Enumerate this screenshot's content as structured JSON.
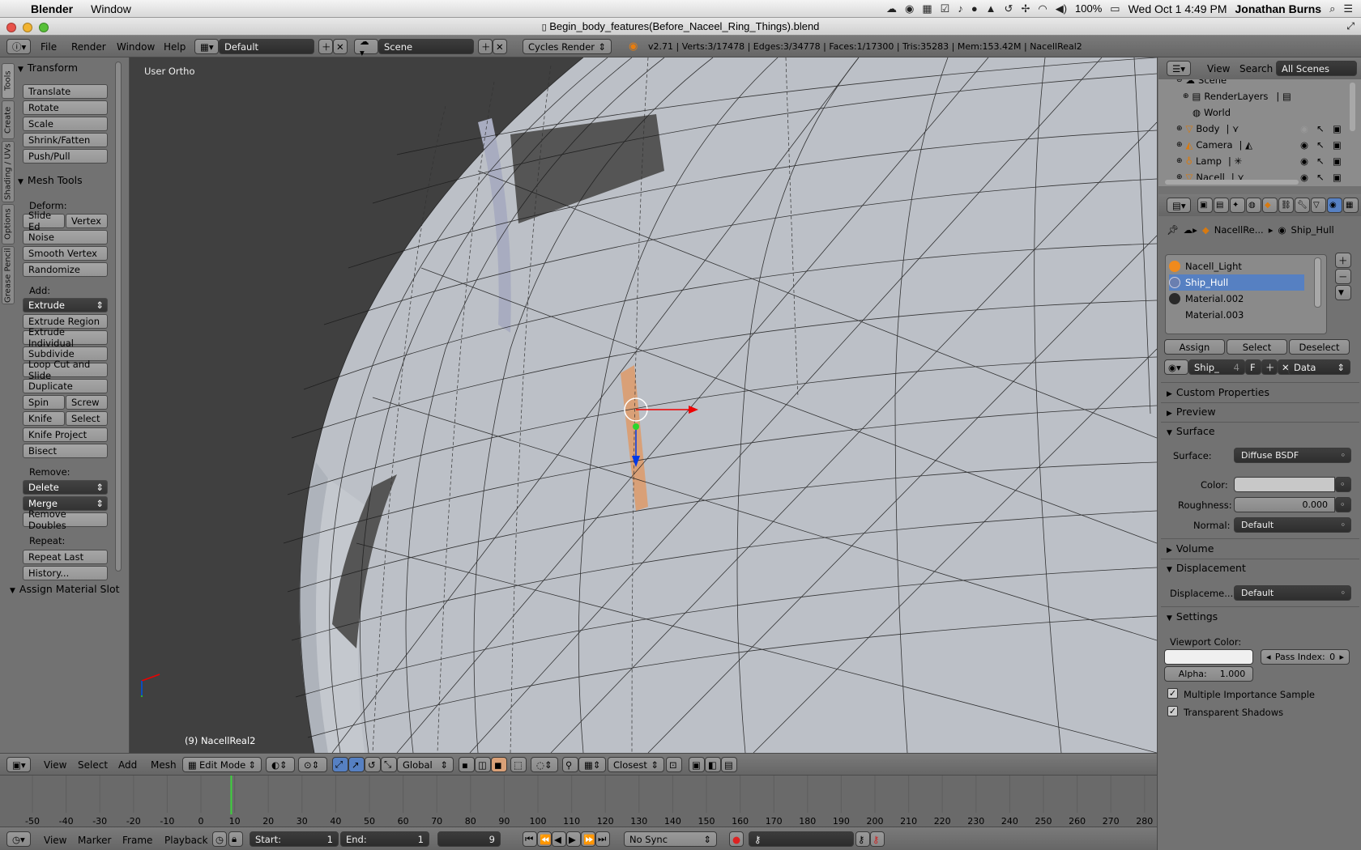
{
  "mac_menubar": {
    "apple": "",
    "app_name": "Blender",
    "window_menu": "Window",
    "battery": "100%",
    "clock": "Wed Oct 1  4:49 PM",
    "user": "Jonathan Burns"
  },
  "window": {
    "title": "Begin_body_features(Before_Naceel_Ring_Things).blend"
  },
  "info_header": {
    "menus": [
      "File",
      "Render",
      "Window",
      "Help"
    ],
    "layout": "Default",
    "scene": "Scene",
    "engine": "Cycles Render",
    "stats": "v2.71 | Verts:3/17478 | Edges:3/34778 | Faces:1/17300 | Tris:35283 | Mem:153.42M | NacellReal2"
  },
  "toolshelf": {
    "tabs": [
      "Tools",
      "Create",
      "Shading / UVs",
      "Options",
      "Grease Pencil"
    ],
    "transform_title": "Transform",
    "transform_buttons": [
      "Translate",
      "Rotate",
      "Scale",
      "Shrink/Fatten",
      "Push/Pull"
    ],
    "meshtools_title": "Mesh Tools",
    "deform_label": "Deform:",
    "slide_edge": "Slide Ed",
    "vertex": "Vertex",
    "noise": "Noise",
    "smooth_vertex": "Smooth Vertex",
    "randomize": "Randomize",
    "add_label": "Add:",
    "extrude": "Extrude",
    "extrude_region": "Extrude Region",
    "extrude_individual": "Extrude Individual",
    "subdivide": "Subdivide",
    "loop_cut": "Loop Cut and Slide",
    "duplicate": "Duplicate",
    "spin": "Spin",
    "screw": "Screw",
    "knife": "Knife",
    "select": "Select",
    "knife_project": "Knife Project",
    "bisect": "Bisect",
    "remove_label": "Remove:",
    "delete": "Delete",
    "merge": "Merge",
    "remove_doubles": "Remove Doubles",
    "repeat_label": "Repeat:",
    "repeat_last": "Repeat Last",
    "history": "History...",
    "assign_material_slot": "Assign Material Slot"
  },
  "viewport": {
    "view_label": "User Ortho",
    "object_label": "(9) NacellReal2"
  },
  "header_3d": {
    "menus": [
      "View",
      "Select",
      "Add",
      "Mesh"
    ],
    "mode": "Edit Mode",
    "orientation": "Global",
    "snap": "Closest"
  },
  "timeline": {
    "ticks": [
      "-50",
      "-40",
      "-30",
      "-20",
      "-10",
      "0",
      "10",
      "20",
      "30",
      "40",
      "50",
      "60",
      "70",
      "80",
      "90",
      "100",
      "110",
      "120",
      "130",
      "140",
      "150",
      "160",
      "170",
      "180",
      "190",
      "200",
      "210",
      "220",
      "230",
      "240",
      "250",
      "260",
      "270",
      "280"
    ],
    "current_frame": 9
  },
  "timeline_header": {
    "menus": [
      "View",
      "Marker",
      "Frame",
      "Playback"
    ],
    "start_label": "Start:",
    "start_value": "1",
    "end_label": "End:",
    "end_value": "1",
    "frame_value": "9",
    "sync": "No Sync"
  },
  "outliner": {
    "menus": [
      "View",
      "Search"
    ],
    "filter": "All Scenes",
    "items": [
      {
        "label": "Scene"
      },
      {
        "label": "RenderLayers"
      },
      {
        "label": "World"
      },
      {
        "label": "Body"
      },
      {
        "label": "Camera"
      },
      {
        "label": "Lamp"
      },
      {
        "label": "Nacell"
      }
    ]
  },
  "properties": {
    "breadcrumb_object": "NacellRe...",
    "breadcrumb_material": "Ship_Hull",
    "slots": [
      {
        "name": "Nacell_Light",
        "color": "#f08a1c"
      },
      {
        "name": "Ship_Hull",
        "color": "#6a7fb0"
      },
      {
        "name": "Material.002",
        "color": "#2a2a2a"
      },
      {
        "name": "Material.003",
        "color": "#8a8a8a"
      }
    ],
    "assign": "Assign",
    "select": "Select",
    "deselect": "Deselect",
    "material_short": "Ship_",
    "users": "4",
    "fake": "F",
    "link": "Data",
    "custom_properties": "Custom Properties",
    "preview": "Preview",
    "surface_section": "Surface",
    "surface_label": "Surface:",
    "surface_value": "Diffuse BSDF",
    "color_label": "Color:",
    "roughness_label": "Roughness:",
    "roughness_value": "0.000",
    "normal_label": "Normal:",
    "normal_value": "Default",
    "volume_section": "Volume",
    "displacement_section": "Displacement",
    "displacement_label": "Displaceme...",
    "displacement_value": "Default",
    "settings_section": "Settings",
    "viewport_color_label": "Viewport Color:",
    "pass_index_label": "Pass Index:",
    "pass_index_value": "0",
    "alpha_label": "Alpha:",
    "alpha_value": "1.000",
    "mis_label": "Multiple Importance Sample",
    "transparent_shadows_label": "Transparent Shadows"
  },
  "colors": {
    "selection_blue": "#5680c2",
    "mesh_face": "#bcc0c7",
    "selected_face": "#d9a077",
    "timeline_marker": "#3cd23c"
  }
}
